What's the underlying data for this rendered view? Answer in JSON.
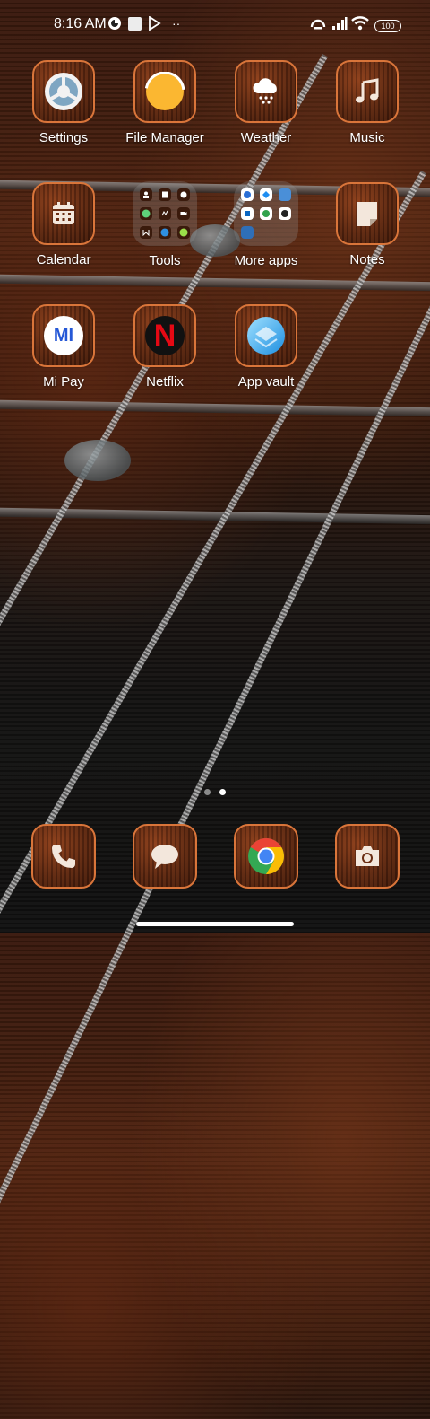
{
  "status_bar": {
    "time": "8:16 AM",
    "battery": "100"
  },
  "apps": [
    {
      "label": "Settings",
      "icon": "settings-icon"
    },
    {
      "label": "File Manager",
      "icon": "file-manager-icon"
    },
    {
      "label": "Weather",
      "icon": "weather-icon"
    },
    {
      "label": "Music",
      "icon": "music-icon"
    },
    {
      "label": "Calendar",
      "icon": "calendar-icon"
    },
    {
      "label": "Tools",
      "icon": "folder-icon"
    },
    {
      "label": "More apps",
      "icon": "folder-icon"
    },
    {
      "label": "Notes",
      "icon": "notes-icon"
    },
    {
      "label": "Mi Pay",
      "icon": "mi-pay-icon",
      "icon_text": "MI"
    },
    {
      "label": "Netflix",
      "icon": "netflix-icon",
      "icon_text": "N"
    },
    {
      "label": "App vault",
      "icon": "app-vault-icon"
    }
  ],
  "dock": [
    {
      "icon": "phone-icon"
    },
    {
      "icon": "messages-icon"
    },
    {
      "icon": "chrome-icon"
    },
    {
      "icon": "camera-icon"
    }
  ],
  "page_indicator": {
    "pages": 2,
    "active": 2
  },
  "colors": {
    "tile_border": "#d9753a",
    "active_dot": "#ffffff",
    "inactive_dot": "#8a8a8a"
  }
}
